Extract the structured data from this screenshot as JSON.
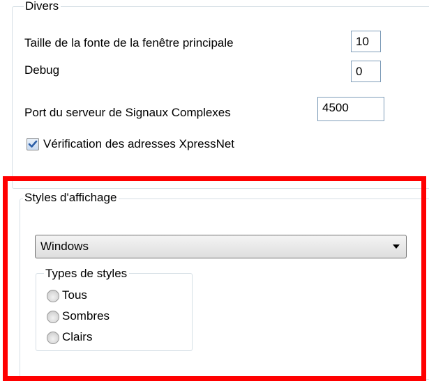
{
  "divers": {
    "title": "Divers",
    "font_size_label": "Taille de la fonte de la fenêtre principale",
    "font_size_value": "10",
    "debug_label": "Debug",
    "debug_value": "0",
    "port_label": "Port du serveur de Signaux Complexes",
    "port_value": "4500",
    "xpressnet_check_label": "Vérification des adresses XpressNet",
    "xpressnet_checked": true
  },
  "styles": {
    "title": "Styles d'affichage",
    "selected_style": "Windows",
    "types_group_title": "Types de styles",
    "types": [
      {
        "label": "Tous",
        "selected": false
      },
      {
        "label": "Sombres",
        "selected": false
      },
      {
        "label": "Clairs",
        "selected": false
      }
    ]
  },
  "colors": {
    "highlight_frame": "#ff0000",
    "groupbox_border": "#d5dfe5",
    "checkmark": "#2c5fa8"
  },
  "icons": {
    "checkbox": "check-icon",
    "dropdown": "chevron-down-icon"
  }
}
